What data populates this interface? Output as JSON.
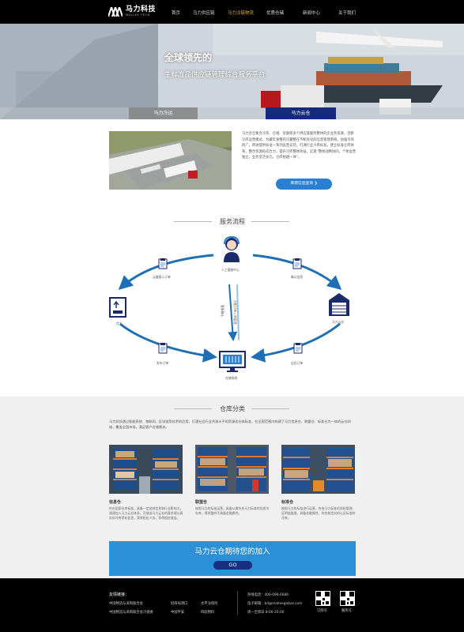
{
  "header": {
    "logo_cn": "马力科技",
    "logo_en": "MALLEE TECH",
    "nav": [
      "首页",
      "马力供应链",
      "马力冷链物流",
      "优质仓储",
      "新闻中心",
      "关于我们"
    ],
    "active_index": 2
  },
  "banner": {
    "title": "全球领先的",
    "subtitle": "生鲜冻品供应链管理综合服务平台",
    "tab_left": "马力冷运",
    "tab_right": "马力云仓"
  },
  "intro": {
    "text": "马力云仓集合冷库、仓储、金融等多个供应链服务整体的企业务资源，创新冷库运营模式，为藏年食整的冷藏整在不断优化的信息管理系统，加强市场的广，跨进提供标准一系列运营支持。打通行业冷库标准，建立标准仓库体系，整合资源形成合力，提升冷库整体效益，实现“整体战略协同，个体运营独立，业务灵活多元，仓库拍越一体”。",
    "button": "库源信息查询"
  },
  "flow": {
    "title": "服务流程",
    "center_top": "人工客服中心",
    "top_left": "云趣客入订单",
    "top_right": "确认信息",
    "left": "货主",
    "right": "马力云仓",
    "bottom_left": "发布订单",
    "bottom_right": "出仓订单",
    "bottom": "仓储系统",
    "mid_left": "客服确认",
    "mid_right": "分配订单入库管理"
  },
  "categories": {
    "title": "仓库分类",
    "desc": "马力科技通过智能系统、物联网、区块链等技术的应用，打通社会行业共源水平的资源化仓体标准，在全国范围内构建了马力信息仓、联盟仓、标准仓为一体的云仓网络，覆盖全国市场，满足客户仓储需求。",
    "items": [
      {
        "name": "信息仓",
        "text": "符合国家仓库标准，具备一定地地信息和行业影响力，通通加入马力云仓体系，开放部马力云仓的要求建以真实的冷库资料信息，获得相应义务，获得相应收益。"
      },
      {
        "name": "联盟仓",
        "text": "按照马力的标准运营，具备从属符合马力标准的优质冷仓库，得到整的不具备金融属性。"
      },
      {
        "name": "标准仓",
        "text": "按照马力的标准进行运营，符合马力标准的质检管理、证明链整理，具备金融属性，符合各定向的认证标准的冷库。"
      }
    ]
  },
  "join": {
    "text": "马力云仓期待您的加入",
    "button": "GO"
  },
  "footer": {
    "links_label": "友情链接：",
    "links": [
      "中国物流与采购联合会",
      "招商局港口",
      "太平洋保险",
      "中国物流与采购联合会冷链委",
      "中国平安",
      "四段物料"
    ],
    "hotline": "热线电话：400-096-6686",
    "email": "电子邮箱：bd@malleeglobal.com",
    "hours": "周一至周日 8:00-20:00",
    "qr1": "订阅号",
    "qr2": "服务号"
  }
}
